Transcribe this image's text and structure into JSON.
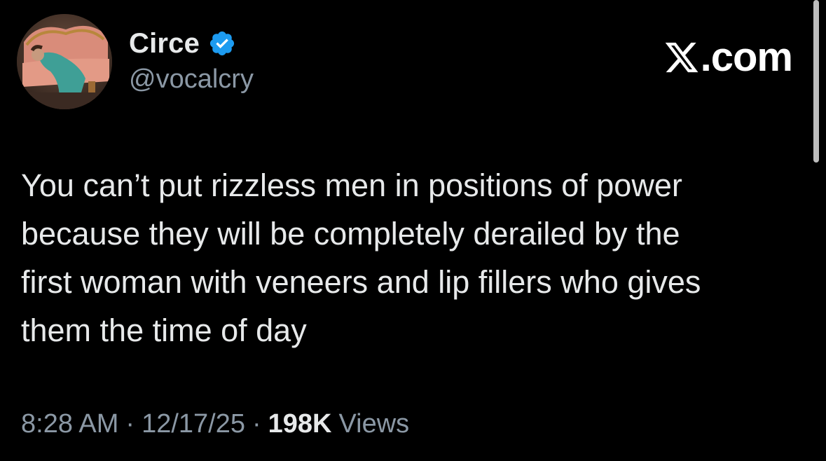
{
  "author": {
    "display_name": "Circe",
    "handle": "@vocalcry",
    "verified": true,
    "verified_color": "#1d9bf0"
  },
  "brand": {
    "text": ".com",
    "icon": "x-logo-icon"
  },
  "tweet": {
    "text": "You can’t put rizzless men in positions of power\nbecause they will be completely derailed by the\nfirst woman with veneers and lip fillers who gives\nthem the time of day"
  },
  "meta": {
    "time": "8:28 AM",
    "separator": "·",
    "date": "12/17/25",
    "views_count": "198K",
    "views_label": "Views"
  },
  "colors": {
    "background": "#000000",
    "primary_text": "#e7e9ea",
    "secondary_text": "#8b98a5"
  }
}
